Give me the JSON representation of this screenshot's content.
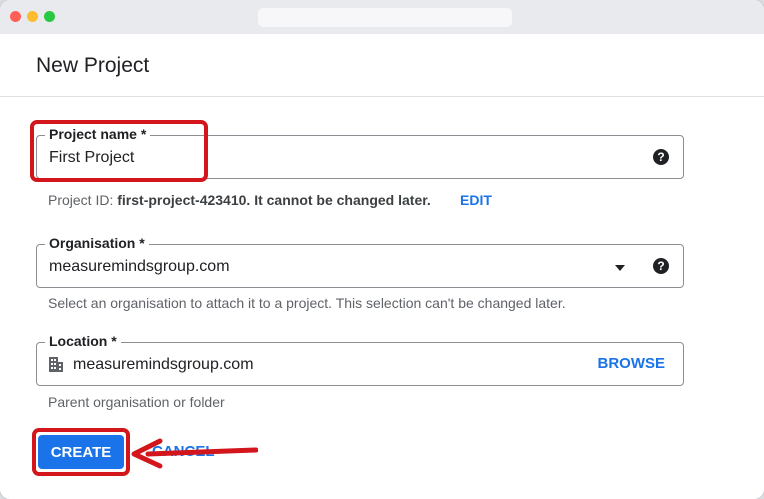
{
  "dialog": {
    "title": "New Project"
  },
  "project_name": {
    "label": "Project name *",
    "value": "First Project"
  },
  "project_id": {
    "prefix": "Project ID: ",
    "id": "first-project-423410.",
    "suffix": " It cannot be changed later.",
    "edit_label": "EDIT"
  },
  "organisation": {
    "label": "Organisation *",
    "value": "measuremindsgroup.com",
    "hint": "Select an organisation to attach it to a project. This selection can't be changed later."
  },
  "location": {
    "label": "Location *",
    "value": "measuremindsgroup.com",
    "browse_label": "BROWSE",
    "hint": "Parent organisation or folder"
  },
  "actions": {
    "create_label": "CREATE",
    "cancel_label": "CANCEL"
  },
  "icons": {
    "help": "help-circle-icon",
    "dropdown": "arrow-drop-down-icon",
    "location": "building-icon"
  },
  "colors": {
    "accent": "#1a73e8",
    "annotation": "#d2161b"
  }
}
